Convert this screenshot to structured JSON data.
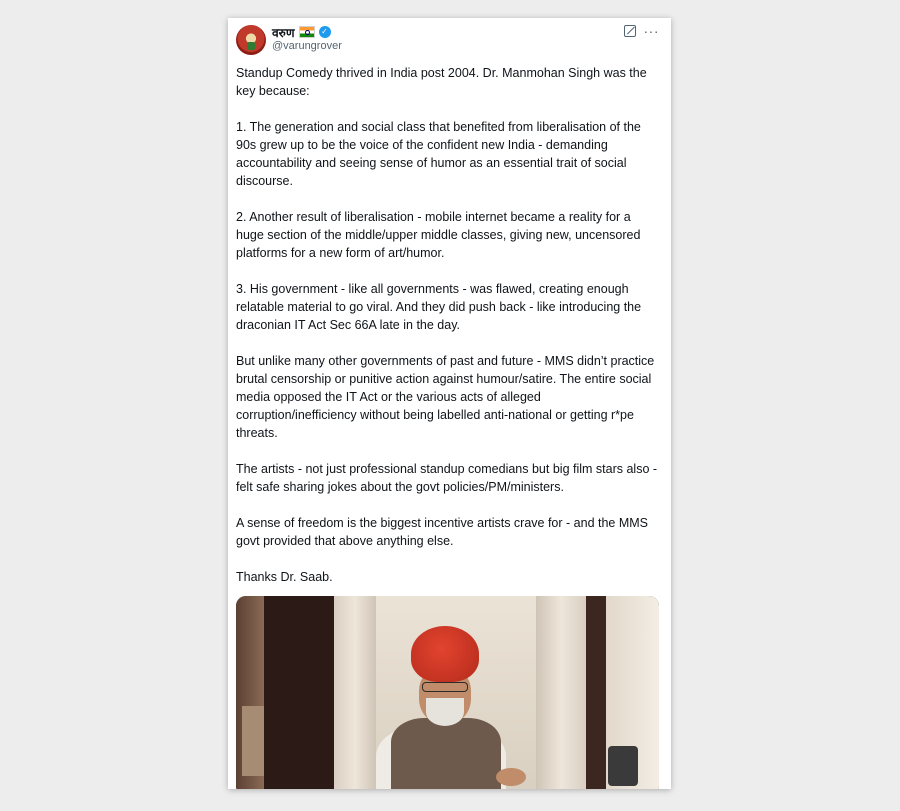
{
  "tweet": {
    "display_name": "वरुण",
    "handle": "@varungrover",
    "flag_icon": "india-flag-icon",
    "verified_icon": "verified-badge-icon",
    "verified_color": "#1d9bf0",
    "paragraphs": [
      "Standup Comedy thrived in India post 2004. Dr. Manmohan Singh was the key because:",
      "1. The generation and social class that benefited from liberalisation of the 90s grew up to be the voice of the confident new India - demanding accountability and seeing sense of humor as an essential trait of social discourse.",
      "2. Another result of liberalisation - mobile internet became a reality for a huge section of the middle/upper middle classes, giving new, uncensored platforms for a new form of art/humor.",
      "3. His government - like all governments - was flawed, creating enough relatable material to go viral. And they did push back - like introducing the draconian IT Act Sec 66A late in the day.",
      "But unlike many other governments of past and future - MMS didn’t practice brutal censorship or punitive action against humour/satire. The entire social media opposed the IT Act or the various acts of alleged corruption/inefficiency without being labelled anti-national or getting r*pe threats.",
      "The artists - not just professional standup comedians but big film stars also - felt safe sharing jokes about the govt policies/PM/ministers.",
      "A sense of freedom is the biggest incentive artists crave for - and the MMS govt provided that above anything else.",
      "Thanks Dr. Saab."
    ]
  },
  "header_actions": {
    "grok_icon": "edit-square-icon",
    "more_icon": "more-options-icon",
    "more_glyph": "···"
  }
}
